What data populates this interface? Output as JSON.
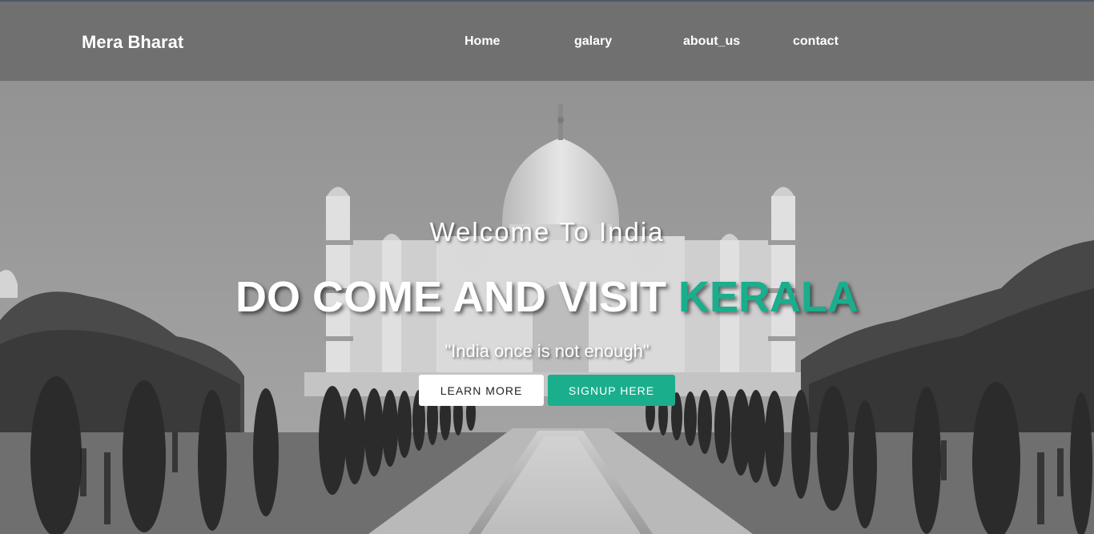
{
  "navbar": {
    "brand": "Mera Bharat",
    "links": [
      "Home",
      "galary",
      "about_us",
      "contact"
    ]
  },
  "hero": {
    "welcome": "Welcome To India",
    "headline_prefix": "DO COME AND VISIT ",
    "headline_accent": "KERALA",
    "tagline": "\"India once is not enough\"",
    "learn_more_label": "LEARN MORE",
    "signup_label": "SIGNUP HERE"
  },
  "colors": {
    "accent": "#1aae8d",
    "navbar_bg": "#6e6e6e",
    "text": "#ffffff"
  },
  "background_image": "taj-mahal-grayscale-photo"
}
